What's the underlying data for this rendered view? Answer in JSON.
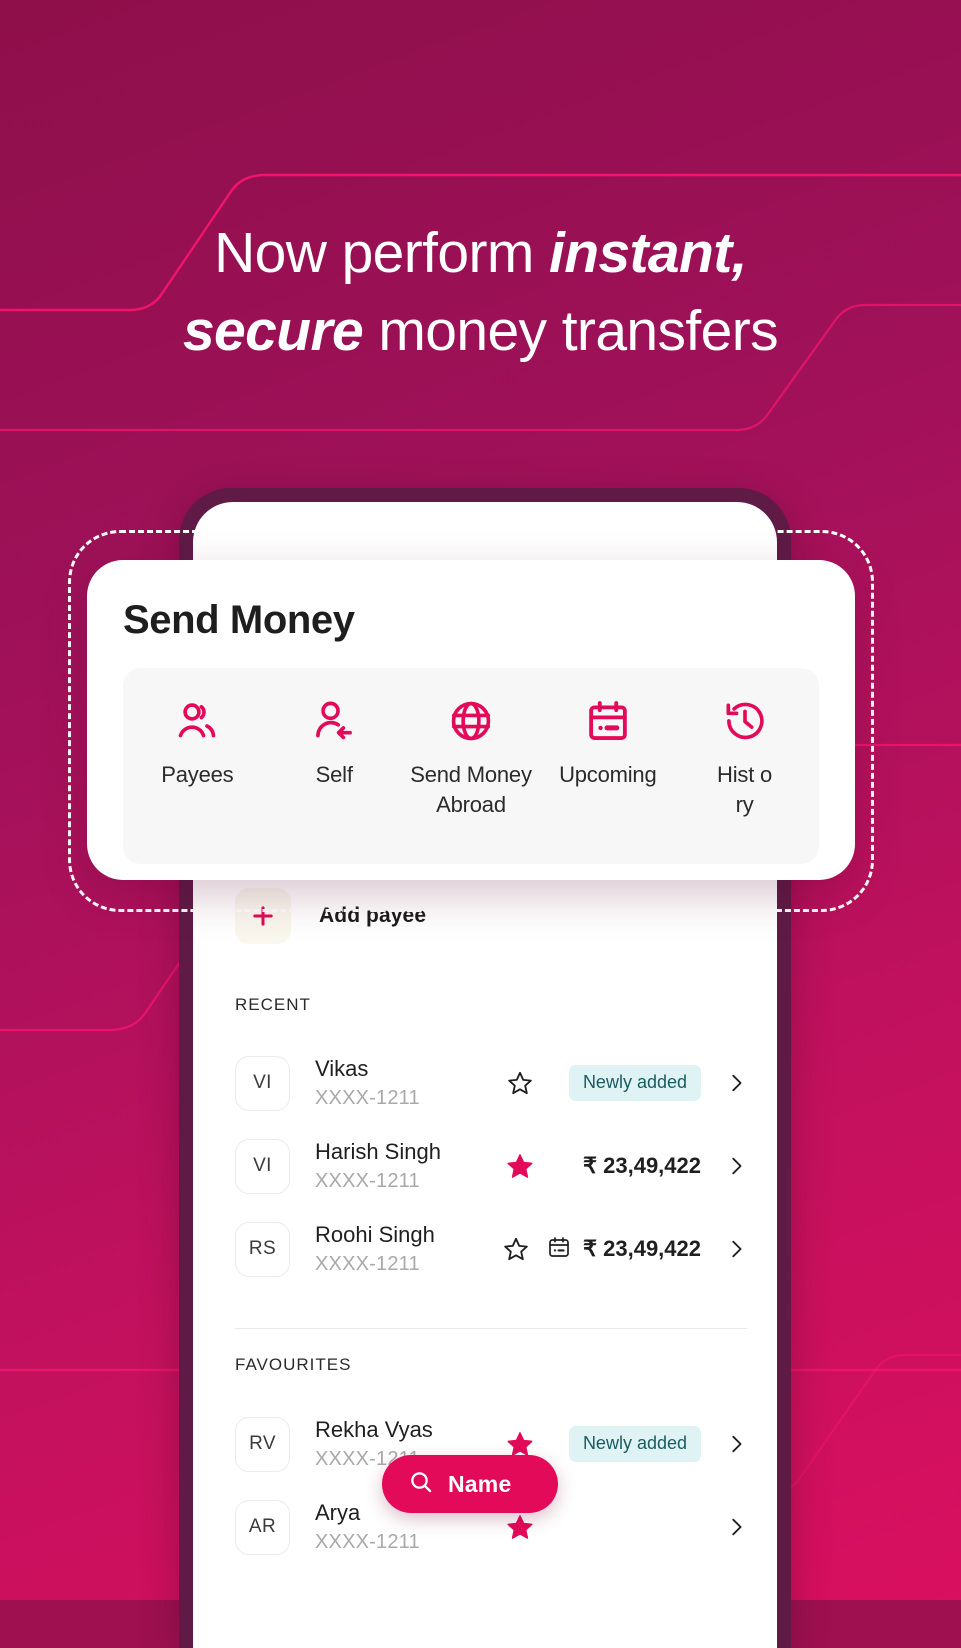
{
  "theme": {
    "brand_pink": "#e30a5a",
    "bg_magenta_top": "#8e0f4a",
    "bg_magenta_bottom": "#d90f5f",
    "phone_frame": "#5f1b46",
    "badge_bg": "#dff2f4",
    "badge_text": "#1a5c62",
    "accent_line": "#f5156c"
  },
  "hero": {
    "headline_part1": "Now perform ",
    "headline_em1": "instant,",
    "headline_em2": "secure",
    "headline_part2": " money transfers"
  },
  "card": {
    "title": "Send Money",
    "tabs": [
      {
        "label": "Payees",
        "icon": "people-icon"
      },
      {
        "label": "Self",
        "icon": "person-arrow-icon"
      },
      {
        "label": "Send Money Abroad",
        "icon": "globe-icon"
      },
      {
        "label": "Upcoming",
        "icon": "calendar-icon"
      },
      {
        "label": "Hist ory",
        "icon": "history-icon"
      }
    ]
  },
  "screen": {
    "add_payee_label": "Add payee",
    "add_payee_icon": "plus-icon",
    "sections": [
      {
        "heading": "RECENT"
      },
      {
        "heading": "FAVOURITES"
      }
    ],
    "recent": [
      {
        "initials": "VI",
        "name": "Vikas",
        "account": "XXXX-1211",
        "starred": false,
        "badge": "Newly added",
        "amount": "",
        "has_calendar": false
      },
      {
        "initials": "VI",
        "name": "Harish Singh",
        "account": "XXXX-1211",
        "starred": true,
        "badge": "",
        "amount": "₹ 23,49,422",
        "has_calendar": false
      },
      {
        "initials": "RS",
        "name": "Roohi Singh",
        "account": "XXXX-1211",
        "starred": false,
        "badge": "",
        "amount": "₹ 23,49,422",
        "has_calendar": true
      }
    ],
    "favourites": [
      {
        "initials": "RV",
        "name": "Rekha Vyas",
        "account": "XXXX-1211",
        "starred": true,
        "badge": "Newly added",
        "amount": "",
        "has_calendar": false
      },
      {
        "initials": "AR",
        "name": "Arya",
        "account": "XXXX-1211",
        "starred": true,
        "badge": "",
        "amount": "",
        "has_calendar": false
      }
    ]
  },
  "search_pill": {
    "label": "Name",
    "icon": "search-icon"
  }
}
